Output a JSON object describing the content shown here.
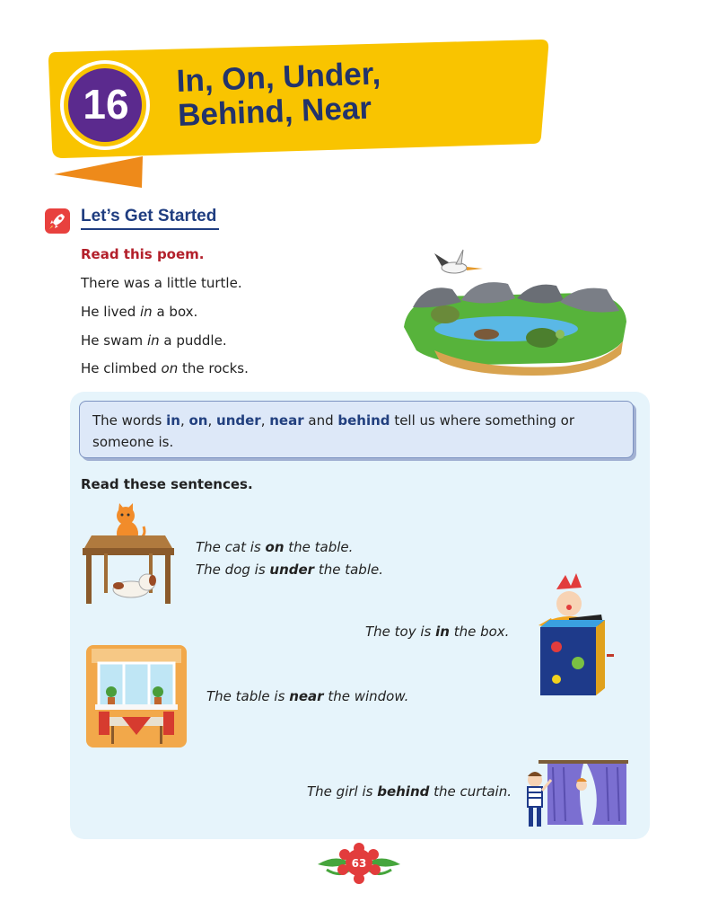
{
  "chapter": {
    "number": "16",
    "title_line1": "In, On, Under,",
    "title_line2": "Behind, Near",
    "colors": {
      "banner": "#f9c400",
      "fold": "#ee8a1a",
      "badge": "#5b2a8e"
    }
  },
  "section": {
    "title": "Let’s Get Started",
    "icon": "rocket-icon",
    "icon_color": "#e8413e"
  },
  "poem": {
    "heading": "Read this poem.",
    "lines": [
      {
        "before": "There was a little turtle.",
        "em": "",
        "after": ""
      },
      {
        "before": "He lived ",
        "em": "in",
        "after": " a box."
      },
      {
        "before": "He swam ",
        "em": "in",
        "after": " a puddle."
      },
      {
        "before": "He climbed ",
        "em": "on",
        "after": " the rocks."
      }
    ]
  },
  "note": {
    "t1": "The words ",
    "k1": "in",
    "c1": ", ",
    "k2": "on",
    "c2": ", ",
    "k3": "under",
    "c3": ", ",
    "k4": "near",
    "t2": " and ",
    "k5": "behind",
    "t3": " tell us where something or someone is."
  },
  "sentences": {
    "heading": "Read these sentences.",
    "cat": {
      "a": "The cat is ",
      "b": "on",
      "c": " the table."
    },
    "dog": {
      "a": "The dog is ",
      "b": "under",
      "c": " the table."
    },
    "toy": {
      "a": "The toy is ",
      "b": "in",
      "c": " the box."
    },
    "window": {
      "a": "The table is ",
      "b": "near",
      "c": " the window."
    },
    "girl": {
      "a": "The girl is ",
      "b": "behind",
      "c": " the curtain."
    }
  },
  "page_number": "63",
  "illustrations": [
    "turtle-pond-illustration",
    "cat-dog-table-illustration",
    "jack-in-the-box-illustration",
    "window-table-illustration",
    "girl-curtain-illustration"
  ]
}
